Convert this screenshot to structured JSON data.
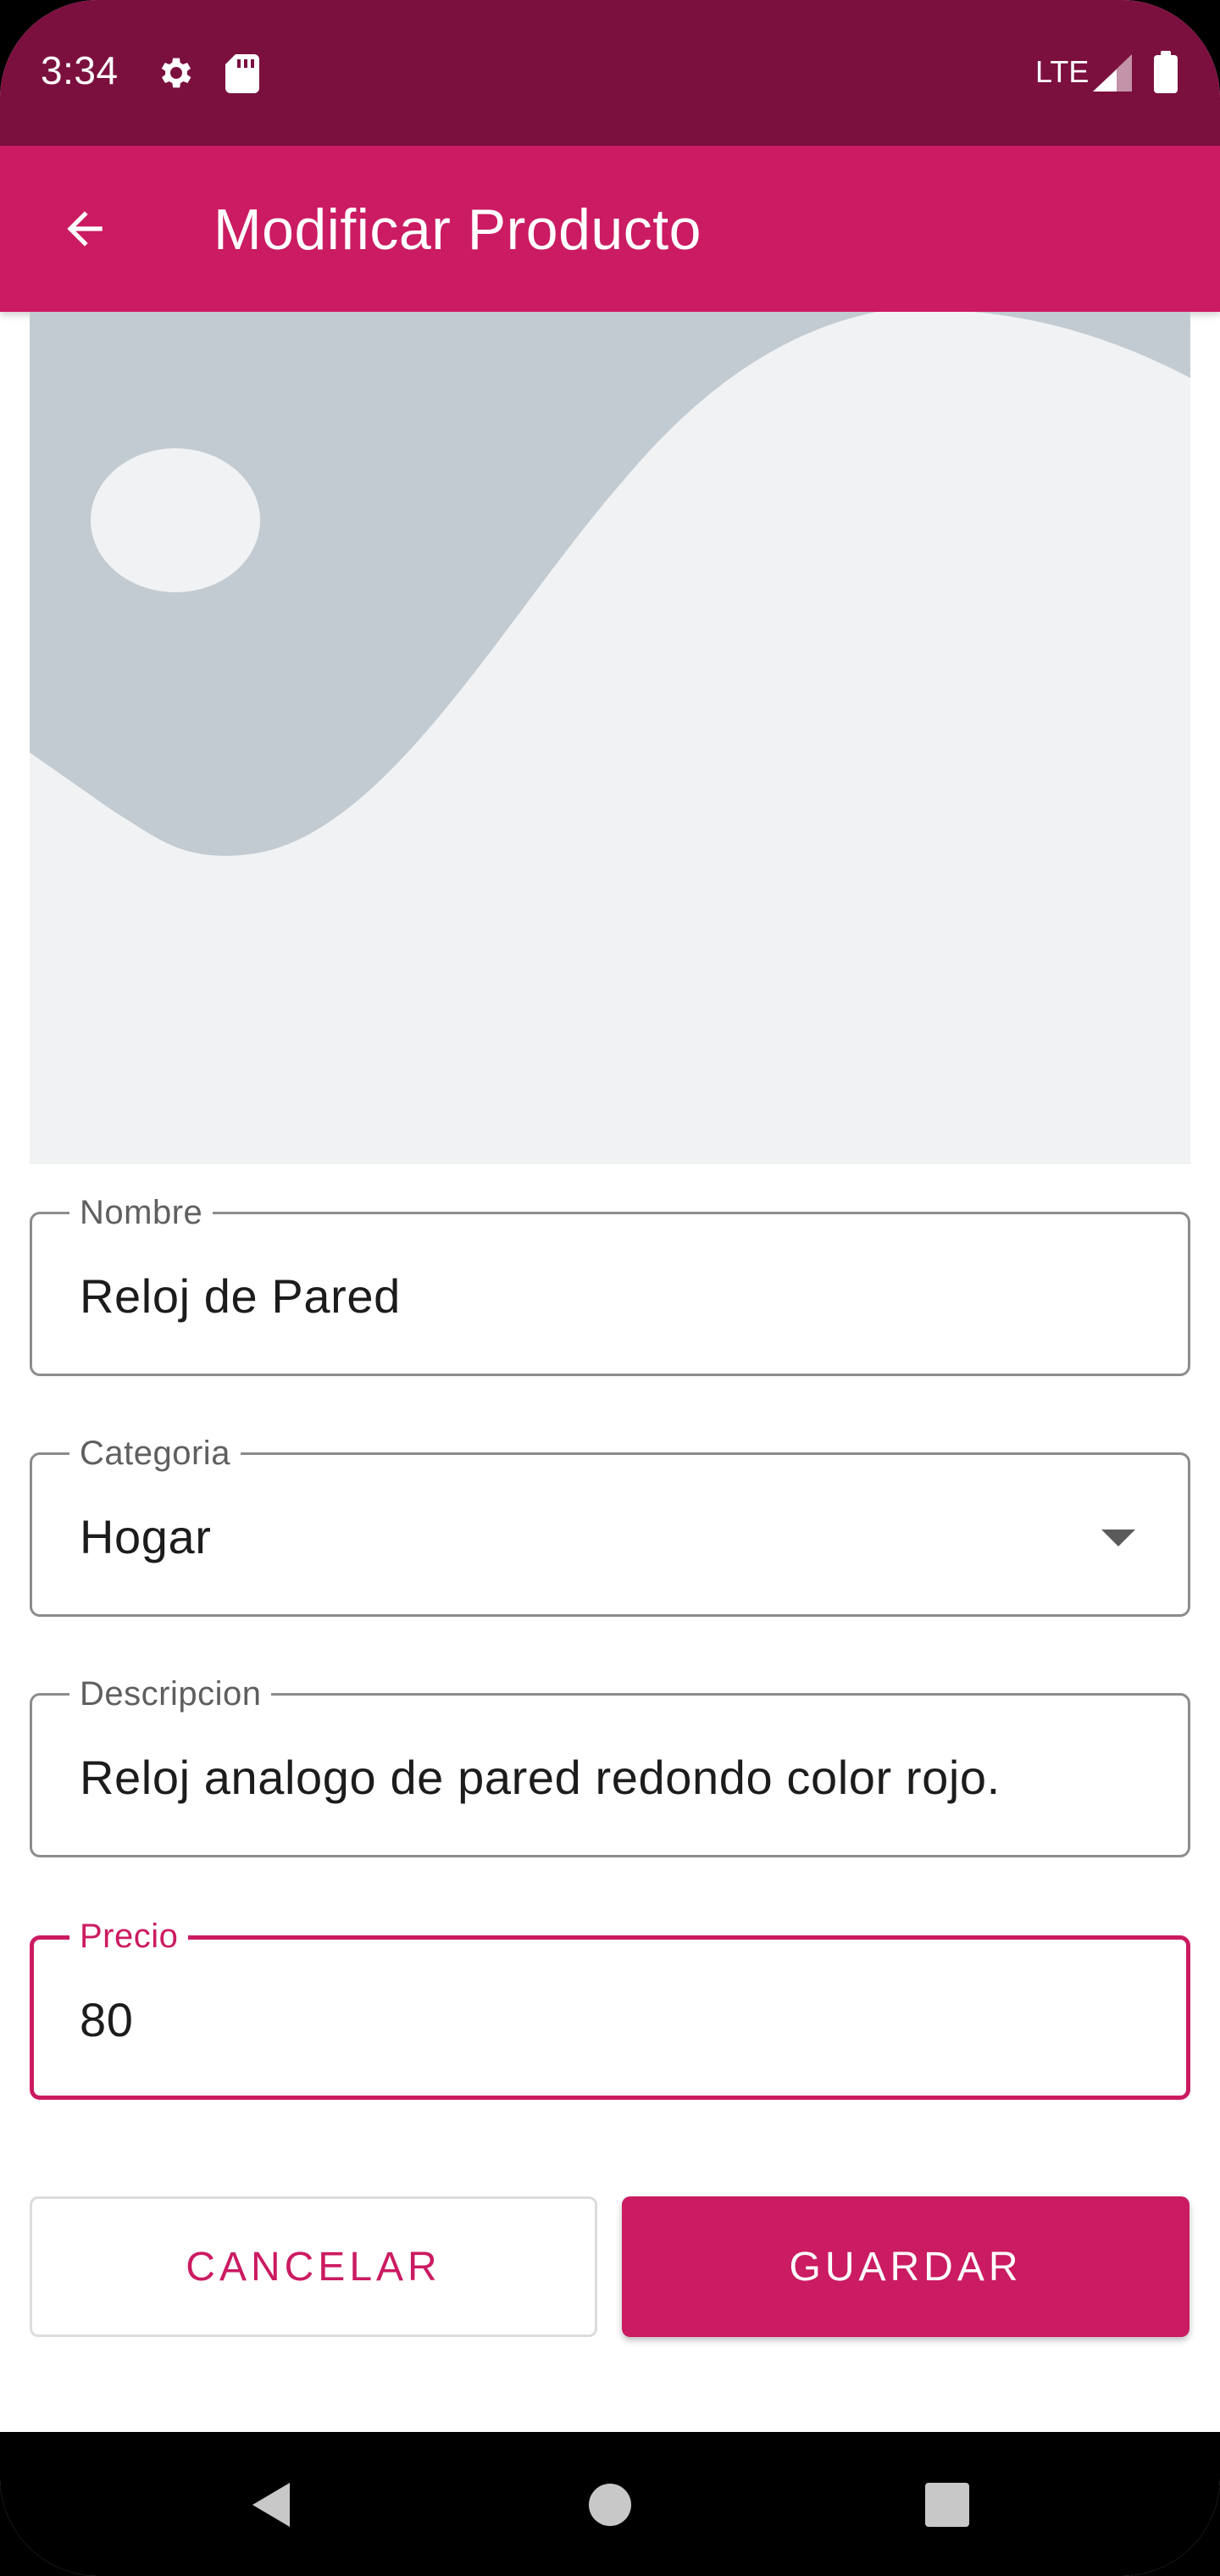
{
  "status_bar": {
    "time": "3:34",
    "network": "LTE",
    "icons": [
      "settings-icon",
      "sd-card-icon",
      "signal-icon",
      "battery-icon"
    ],
    "background": "#7b103f"
  },
  "app_bar": {
    "title": "Modificar Producto",
    "back_icon": "arrow-back-icon",
    "background": "#cb1b62"
  },
  "product_image": {
    "icon": "image-placeholder"
  },
  "form": {
    "nombre": {
      "label": "Nombre",
      "value": "Reloj de Pared"
    },
    "categoria": {
      "label": "Categoria",
      "value": "Hogar"
    },
    "descripcion": {
      "label": "Descripcion",
      "value": "Reloj analogo de pared redondo color rojo."
    },
    "precio": {
      "label": "Precio",
      "value": "80",
      "focused": true
    }
  },
  "actions": {
    "cancel_label": "CANCELAR",
    "save_label": "GUARDAR"
  },
  "nav_bar": {
    "icons": [
      "back-triangle-icon",
      "home-circle-icon",
      "recents-square-icon"
    ]
  },
  "colors": {
    "accent": "#cb1b62",
    "status_bar": "#7b103f",
    "image_placeholder_bg": "#f1f2f3",
    "image_placeholder_shape": "#c2cbd2"
  }
}
